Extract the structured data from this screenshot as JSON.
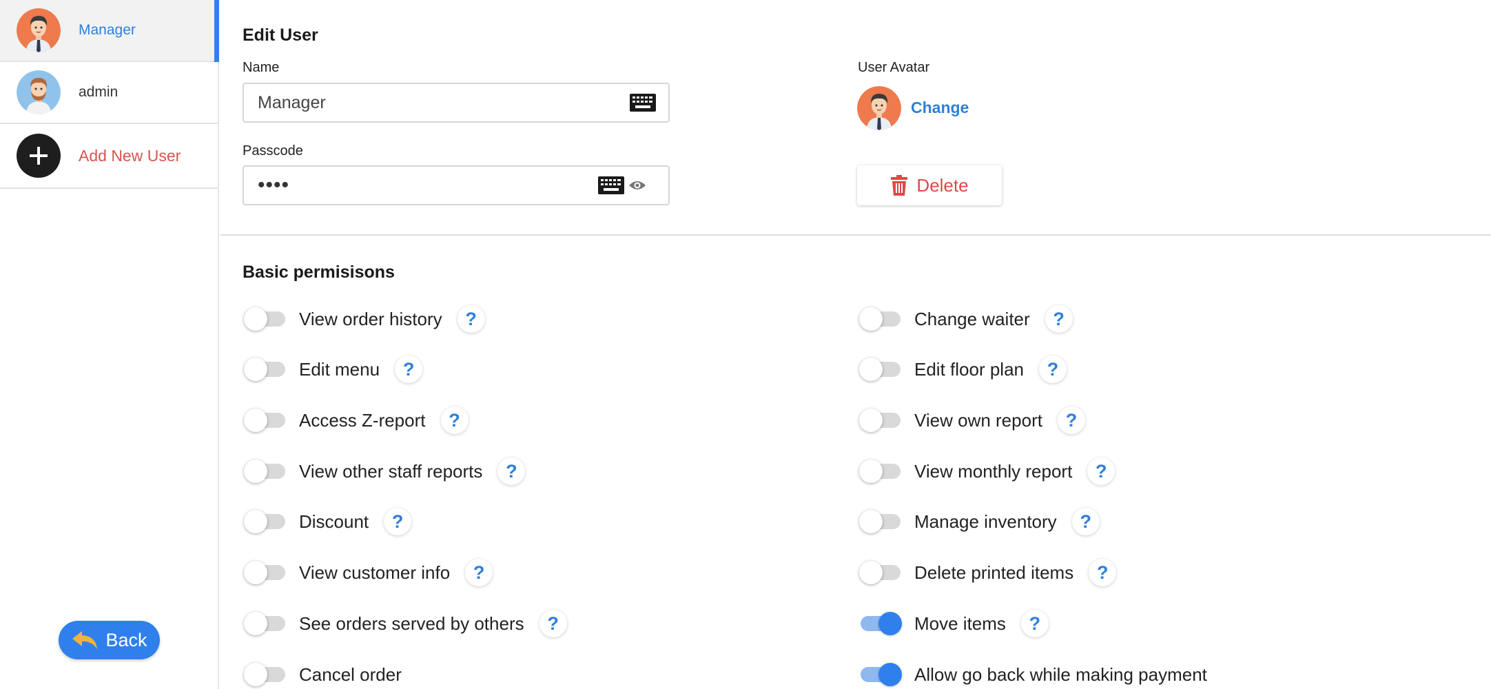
{
  "sidebar": {
    "users": [
      {
        "name": "Manager",
        "avatar": "manager-avatar-icon",
        "active": true
      },
      {
        "name": "admin",
        "avatar": "admin-avatar-icon",
        "active": false
      }
    ],
    "add_label": "Add New User",
    "back_label": "Back"
  },
  "edit": {
    "title": "Edit User",
    "name_label": "Name",
    "name_value": "Manager",
    "passcode_label": "Passcode",
    "passcode_value": "••••",
    "avatar_label": "User Avatar",
    "change_label": "Change",
    "delete_label": "Delete"
  },
  "permissions": {
    "title": "Basic permisisons",
    "left": [
      {
        "label": "View order history",
        "on": false,
        "help": "?"
      },
      {
        "label": "Edit menu",
        "on": false,
        "help": "?"
      },
      {
        "label": "Access Z-report",
        "on": false,
        "help": "?"
      },
      {
        "label": "View other staff reports",
        "on": false,
        "help": "?"
      },
      {
        "label": "Discount",
        "on": false,
        "help": "?"
      },
      {
        "label": "View customer info",
        "on": false,
        "help": "?"
      },
      {
        "label": "See orders served by others",
        "on": false,
        "help": "?"
      },
      {
        "label": "Cancel order",
        "on": false,
        "help": ""
      }
    ],
    "right": [
      {
        "label": "Change waiter",
        "on": false,
        "help": "?"
      },
      {
        "label": "Edit floor plan",
        "on": false,
        "help": "?"
      },
      {
        "label": "View own report",
        "on": false,
        "help": "?"
      },
      {
        "label": "View monthly report",
        "on": false,
        "help": "?"
      },
      {
        "label": "Manage inventory",
        "on": false,
        "help": "?"
      },
      {
        "label": "Delete printed items",
        "on": false,
        "help": "?"
      },
      {
        "label": "Move items",
        "on": true,
        "help": "?"
      },
      {
        "label": "Allow go back while making payment",
        "on": true,
        "help": ""
      }
    ]
  },
  "colors": {
    "accent": "#2f80ed",
    "danger": "#e04848",
    "add_user": "#d9534f"
  }
}
